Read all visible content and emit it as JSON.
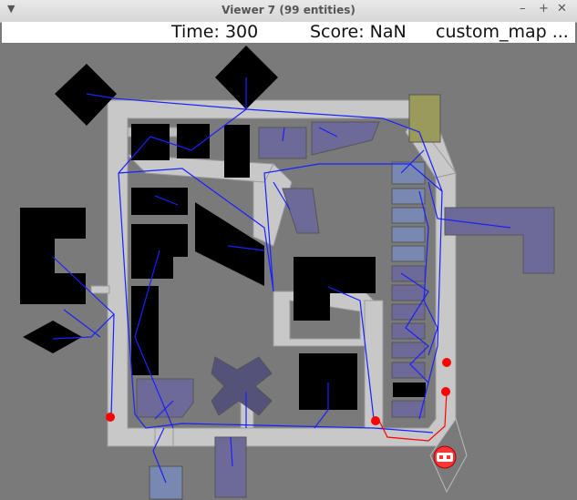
{
  "window": {
    "title": "Viewer 7 (99 entities)",
    "menu_icon": "chevron-down-icon",
    "minimize_icon": "minimize-icon",
    "maximize_icon": "maximize-icon",
    "close_icon": "close-icon"
  },
  "hud": {
    "time": "Time: 300",
    "score": "Score: NaN",
    "map_name": "custom_map ..."
  },
  "colors": {
    "background": "#7a7a7a",
    "wall": "#c8c8c8",
    "obstacle": "#000000",
    "zone_purple": "#6e6a98",
    "zone_blue": "#7888b0",
    "zone_olive": "#9a9a5a",
    "path_blue": "#1a20ff",
    "agent_red": "#ff0000"
  },
  "agent": {
    "icon": "robot-icon"
  }
}
